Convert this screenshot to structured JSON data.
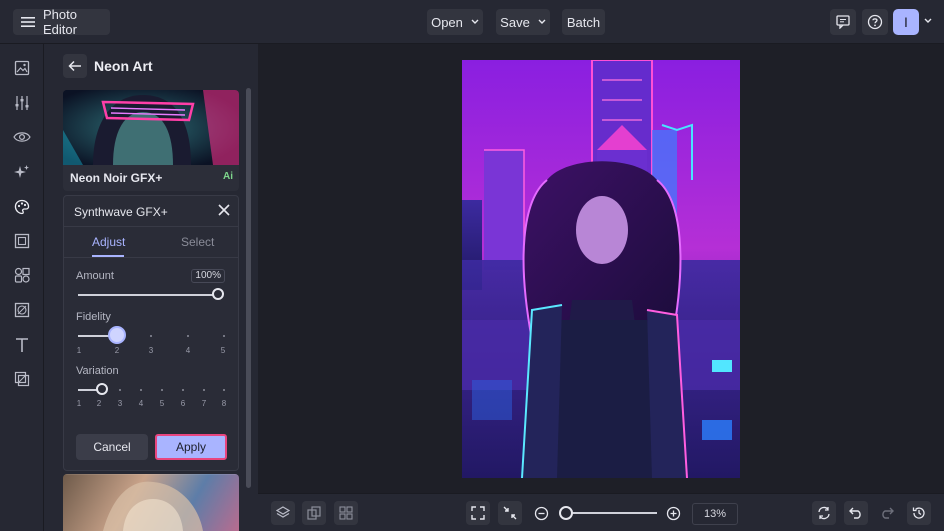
{
  "app": {
    "title": "Photo Editor"
  },
  "topbar": {
    "open_label": "Open",
    "save_label": "Save",
    "batch_label": "Batch",
    "avatar_initial": "I"
  },
  "panel": {
    "title": "Neon Art",
    "card1": {
      "name": "Neon Noir GFX+",
      "badge": "Ai"
    },
    "effect": {
      "title": "Synthwave GFX+",
      "tabs": [
        "Adjust",
        "Select"
      ],
      "amount": {
        "label": "Amount",
        "value": "100%"
      },
      "fidelity": {
        "label": "Fidelity",
        "ticks": [
          "1",
          "2",
          "3",
          "4",
          "5"
        ],
        "value": 2
      },
      "variation": {
        "label": "Variation",
        "ticks": [
          "1",
          "2",
          "3",
          "4",
          "5",
          "6",
          "7",
          "8"
        ],
        "value": 2
      },
      "cancel_label": "Cancel",
      "apply_label": "Apply"
    }
  },
  "bottombar": {
    "zoom": "13%"
  },
  "colors": {
    "accent": "#a9b4ff",
    "highlight": "#e8457e",
    "ai": "#7ed58c"
  }
}
